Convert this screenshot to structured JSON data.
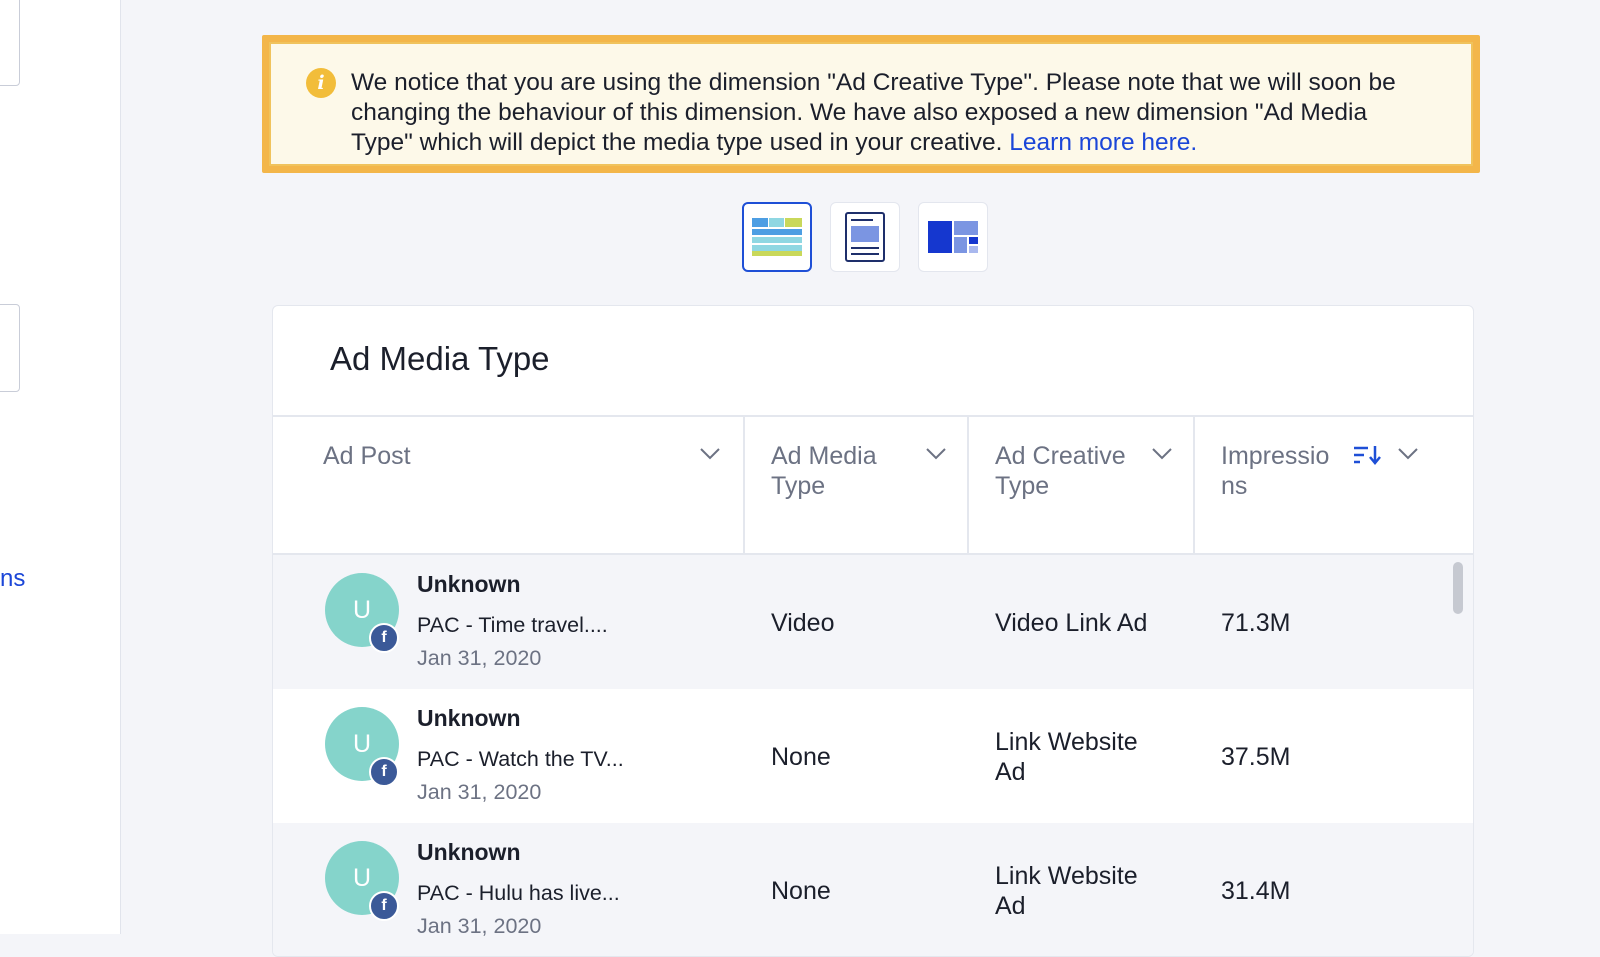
{
  "sidebar": {
    "link_fragment": "ns"
  },
  "banner": {
    "icon": "info-icon",
    "text": "We notice that you are using the dimension \"Ad Creative Type\". Please note that we will soon be changing the behaviour of this dimension. We have also exposed a new dimension \"Ad Media Type\" which will depict the media type used in your creative.",
    "link_text": "Learn more here."
  },
  "view_toggles": [
    {
      "name": "table-view",
      "icon": "table-view-icon",
      "active": true
    },
    {
      "name": "post-view",
      "icon": "post-list-view-icon",
      "active": false
    },
    {
      "name": "treemap-view",
      "icon": "treemap-view-icon",
      "active": false
    }
  ],
  "card": {
    "title": "Ad Media Type",
    "columns": [
      "Ad Post",
      "Ad Media Type",
      "Ad Creative Type",
      "Impressions"
    ],
    "column_display": [
      "Ad Post",
      "Ad Media\nType",
      "Ad Creative\nType",
      "Impressio\nns"
    ],
    "rows": [
      {
        "avatar_letter": "U",
        "network": "facebook",
        "name": "Unknown",
        "post": "PAC - Time travel....",
        "date": "Jan 31, 2020",
        "media_type": "Video",
        "creative_type": "Video Link Ad",
        "impressions": "71.3M"
      },
      {
        "avatar_letter": "U",
        "network": "facebook",
        "name": "Unknown",
        "post": "PAC - Watch the TV...",
        "date": "Jan 31, 2020",
        "media_type": "None",
        "creative_type": "Link Website Ad",
        "impressions": "37.5M"
      },
      {
        "avatar_letter": "U",
        "network": "facebook",
        "name": "Unknown",
        "post": "PAC - Hulu has live...",
        "date": "Jan 31, 2020",
        "media_type": "None",
        "creative_type": "Link Website Ad",
        "impressions": "31.4M"
      }
    ]
  },
  "colors": {
    "accent": "#1e4fd6",
    "warning_border": "#f3b64a",
    "warning_bg": "#fdf9e9",
    "avatar": "#85d4cb",
    "facebook": "#3b5998"
  }
}
